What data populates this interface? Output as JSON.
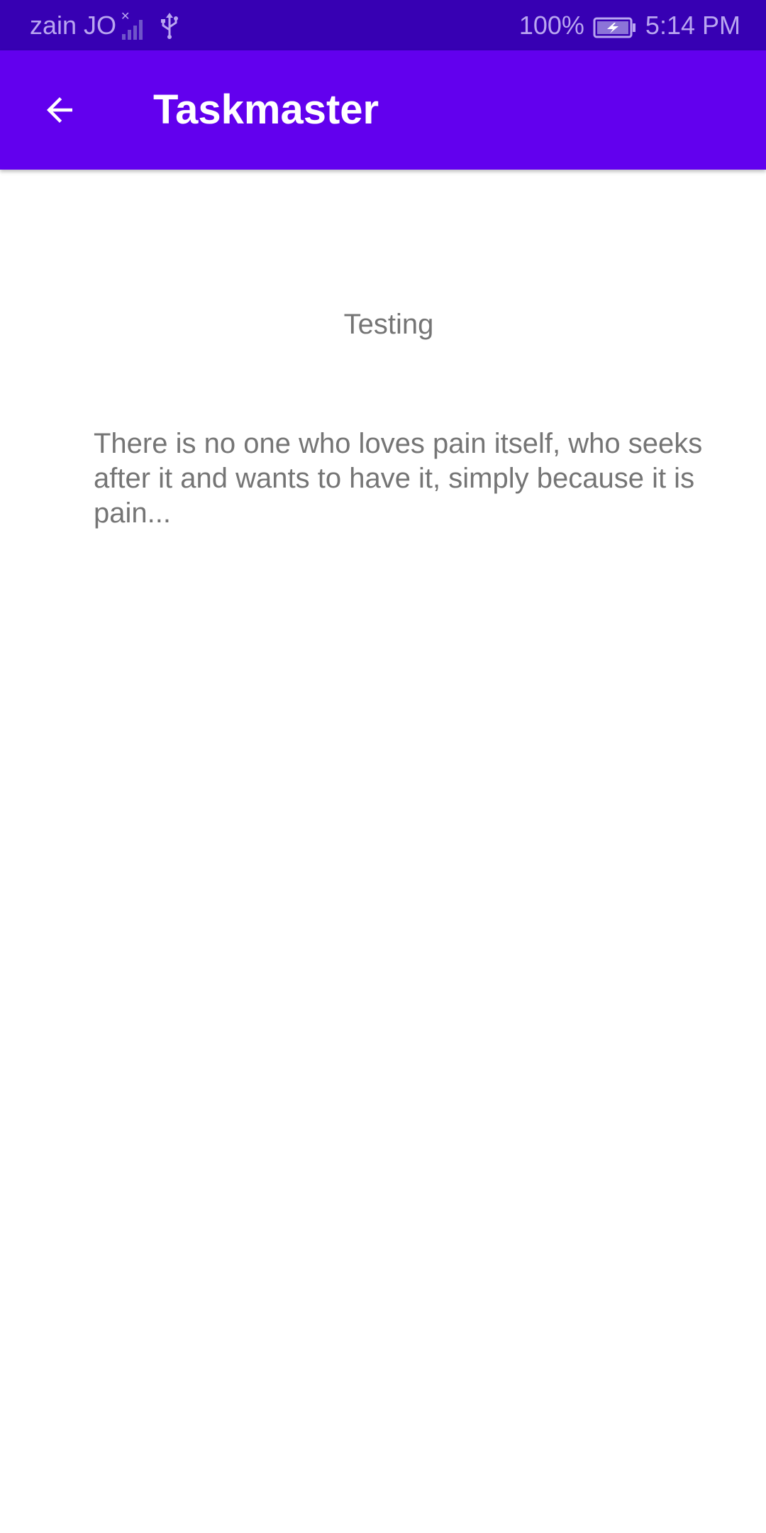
{
  "status_bar": {
    "carrier": "zain JO",
    "battery_percent": "100%",
    "time": "5:14 PM",
    "icons": [
      "signal-icon",
      "usb-icon",
      "battery-charging-icon"
    ],
    "colors": {
      "background": "#3700b3",
      "text": "#b9a6f0"
    }
  },
  "app_bar": {
    "title": "Taskmaster",
    "back_icon": "arrow-back-icon",
    "colors": {
      "background": "#6200ee",
      "text": "#ffffff"
    }
  },
  "task": {
    "title": "Testing",
    "body": "There is no one who loves pain itself, who seeks after it and wants to have it, simply because it is pain...",
    "colors": {
      "text": "#757575"
    }
  }
}
